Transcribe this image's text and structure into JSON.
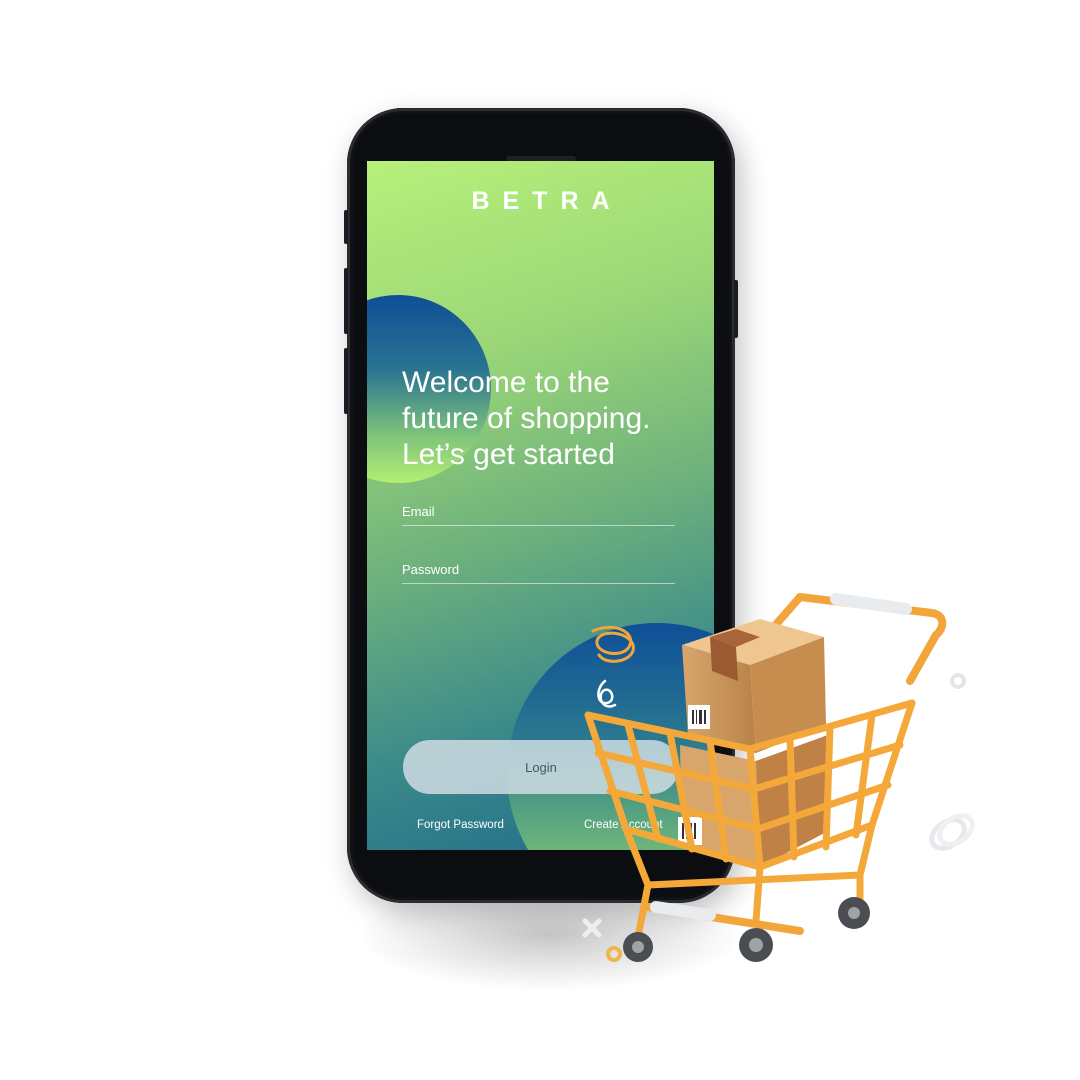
{
  "app": {
    "brand": "BETRA",
    "headline_lines": [
      "Welcome to the",
      "future of shopping.",
      "Let’s get started"
    ]
  },
  "form": {
    "email_label": "Email",
    "password_label": "Password",
    "login_label": "Login"
  },
  "links": {
    "forgot_password": "Forgot Password",
    "create_account": "Create Account"
  },
  "icons": [
    "shopping-cart-icon",
    "cardboard-box-icon",
    "spiral-icon",
    "close-x-icon",
    "ring-icon"
  ],
  "colors": {
    "gradient_top": "#b7f07a",
    "gradient_bottom": "#1f6a8b",
    "blob_blue": "#0f4e96",
    "cart_orange": "#f5a83a",
    "box_tan": "#d9a56b"
  }
}
